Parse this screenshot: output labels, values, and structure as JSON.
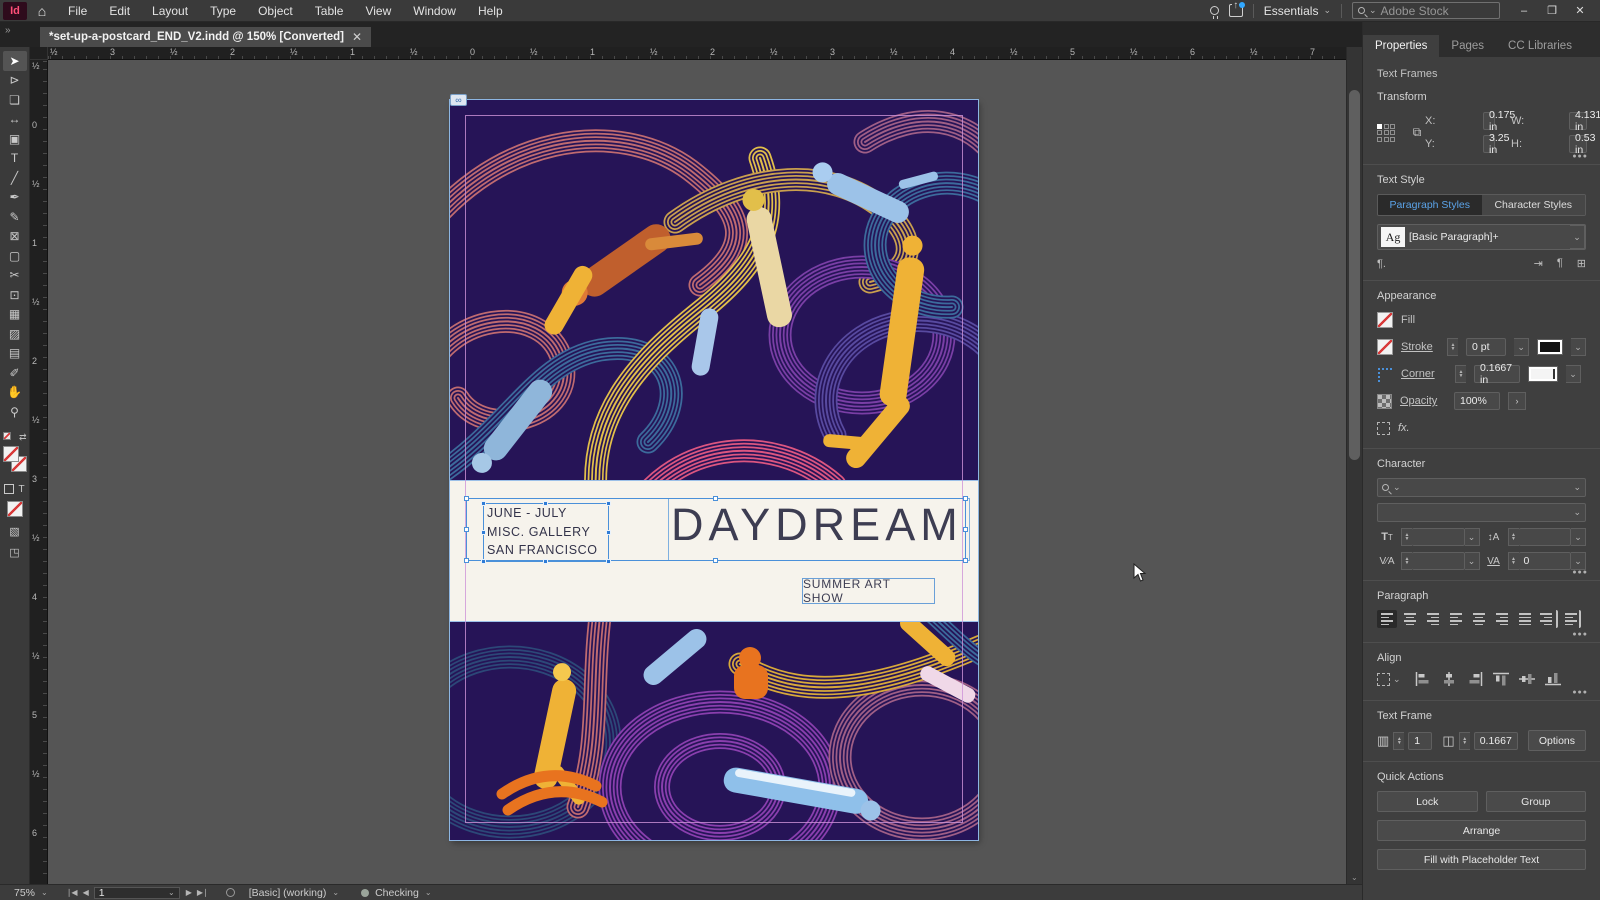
{
  "colors": {
    "selection_blue": "#4a90d9",
    "accent_blue": "#5ba3e8",
    "artwork_bg": "#261457",
    "none_red": "#d83a3a",
    "share_badge_blue": "#31a8ff"
  },
  "app": {
    "logo": "Id",
    "menu": [
      "File",
      "Edit",
      "Layout",
      "Type",
      "Object",
      "Table",
      "View",
      "Window",
      "Help"
    ],
    "workspace": "Essentials",
    "search_placeholder": "Adobe Stock",
    "window_minimize": "–",
    "window_restore": "❐",
    "window_close": "✕"
  },
  "icons": {
    "home": "⌂",
    "chevron_down": "⌄",
    "chevron_right": "›",
    "double_chevron": "»",
    "more": "●●●",
    "first_page": "❘◀",
    "prev_page": "◀",
    "next_page": "▶",
    "last_page": "▶❘",
    "columns": "▥",
    "gutter": "◫",
    "spread": "◫",
    "pilcrow_dot": "¶.",
    "redefine": "⇥",
    "override": "¶",
    "new_style": "⊞",
    "fx": "fx.",
    "swap": "⇄",
    "link_badge": "∞",
    "search_chevron": "⌄"
  },
  "tab": {
    "title": "*set-up-a-postcard_END_V2.indd @ 150% [Converted]",
    "close": "✕"
  },
  "rulers": {
    "horizontal": [
      "½",
      "3",
      "½",
      "2",
      "½",
      "1",
      "½",
      "0",
      "½",
      "1",
      "½",
      "2",
      "½",
      "3",
      "½",
      "4",
      "½",
      "5",
      "½",
      "6",
      "½",
      "7"
    ],
    "vertical": [
      "½",
      "0",
      "½",
      "1",
      "½",
      "2",
      "½",
      "3",
      "½",
      "4",
      "½",
      "5",
      "½",
      "6"
    ]
  },
  "tools": [
    {
      "name": "selection-tool",
      "glyph": "➤",
      "active": true
    },
    {
      "name": "direct-selection-tool",
      "glyph": "⊳"
    },
    {
      "name": "page-tool",
      "glyph": "❏"
    },
    {
      "name": "gap-tool",
      "glyph": "↔"
    },
    {
      "name": "content-collector-tool",
      "glyph": "▣"
    },
    {
      "name": "type-tool",
      "glyph": "T"
    },
    {
      "name": "line-tool",
      "glyph": "╱"
    },
    {
      "name": "pen-tool",
      "glyph": "✒"
    },
    {
      "name": "pencil-tool",
      "glyph": "✎"
    },
    {
      "name": "frame-tool",
      "glyph": "⊠"
    },
    {
      "name": "rectangle-tool",
      "glyph": "▢"
    },
    {
      "name": "scissors-tool",
      "glyph": "✂"
    },
    {
      "name": "free-transform-tool",
      "glyph": "⊡"
    },
    {
      "name": "gradient-swatch-tool",
      "glyph": "▦"
    },
    {
      "name": "gradient-feather-tool",
      "glyph": "▨"
    },
    {
      "name": "note-tool",
      "glyph": "▤"
    },
    {
      "name": "eyedropper-tool",
      "glyph": "✐"
    },
    {
      "name": "hand-tool",
      "glyph": "✋"
    },
    {
      "name": "zoom-tool",
      "glyph": "⚲"
    }
  ],
  "postcard": {
    "venue_lines": "JUNE - JULY\nMISC. GALLERY\nSAN FRANCISCO",
    "title": "DAYDREAM",
    "subtitle": "SUMMER ART SHOW"
  },
  "statusbar": {
    "zoom": "75%",
    "page": "1",
    "preflight_profile": "[Basic] (working)",
    "preflight_status": "Checking"
  },
  "properties": {
    "tabs": [
      {
        "label": "Properties",
        "name": "tab-properties",
        "active": true
      },
      {
        "label": "Pages",
        "name": "tab-pages"
      },
      {
        "label": "CC Libraries",
        "name": "tab-cc-libraries"
      }
    ],
    "selection_label": "Text Frames",
    "transform": {
      "title": "Transform",
      "x_label": "X:",
      "x_value": "0.175 in",
      "y_label": "Y:",
      "y_value": "3.25 in",
      "w_label": "W:",
      "w_value": "4.1317 in",
      "h_label": "H:",
      "h_value": "0.53 in"
    },
    "text_style": {
      "title": "Text Style",
      "paragraph_tab": "Paragraph Styles",
      "character_tab": "Character Styles",
      "badge": "Ag",
      "style_name": "[Basic Paragraph]+"
    },
    "appearance": {
      "title": "Appearance",
      "fill_label": "Fill",
      "stroke_label": "Stroke",
      "stroke_weight": "0 pt",
      "corner_label": "Corner",
      "corner_radius": "0.1667 in",
      "opacity_label": "Opacity",
      "opacity_value": "100%"
    },
    "character": {
      "title": "Character",
      "tracking_value": "0"
    },
    "paragraph": {
      "title": "Paragraph"
    },
    "align": {
      "title": "Align"
    },
    "text_frame": {
      "title": "Text Frame",
      "columns": "1",
      "inset": "0.1667",
      "options": "Options"
    },
    "quick_actions": {
      "title": "Quick Actions",
      "lock": "Lock",
      "group": "Group",
      "arrange": "Arrange",
      "fill_placeholder": "Fill with Placeholder Text"
    }
  }
}
